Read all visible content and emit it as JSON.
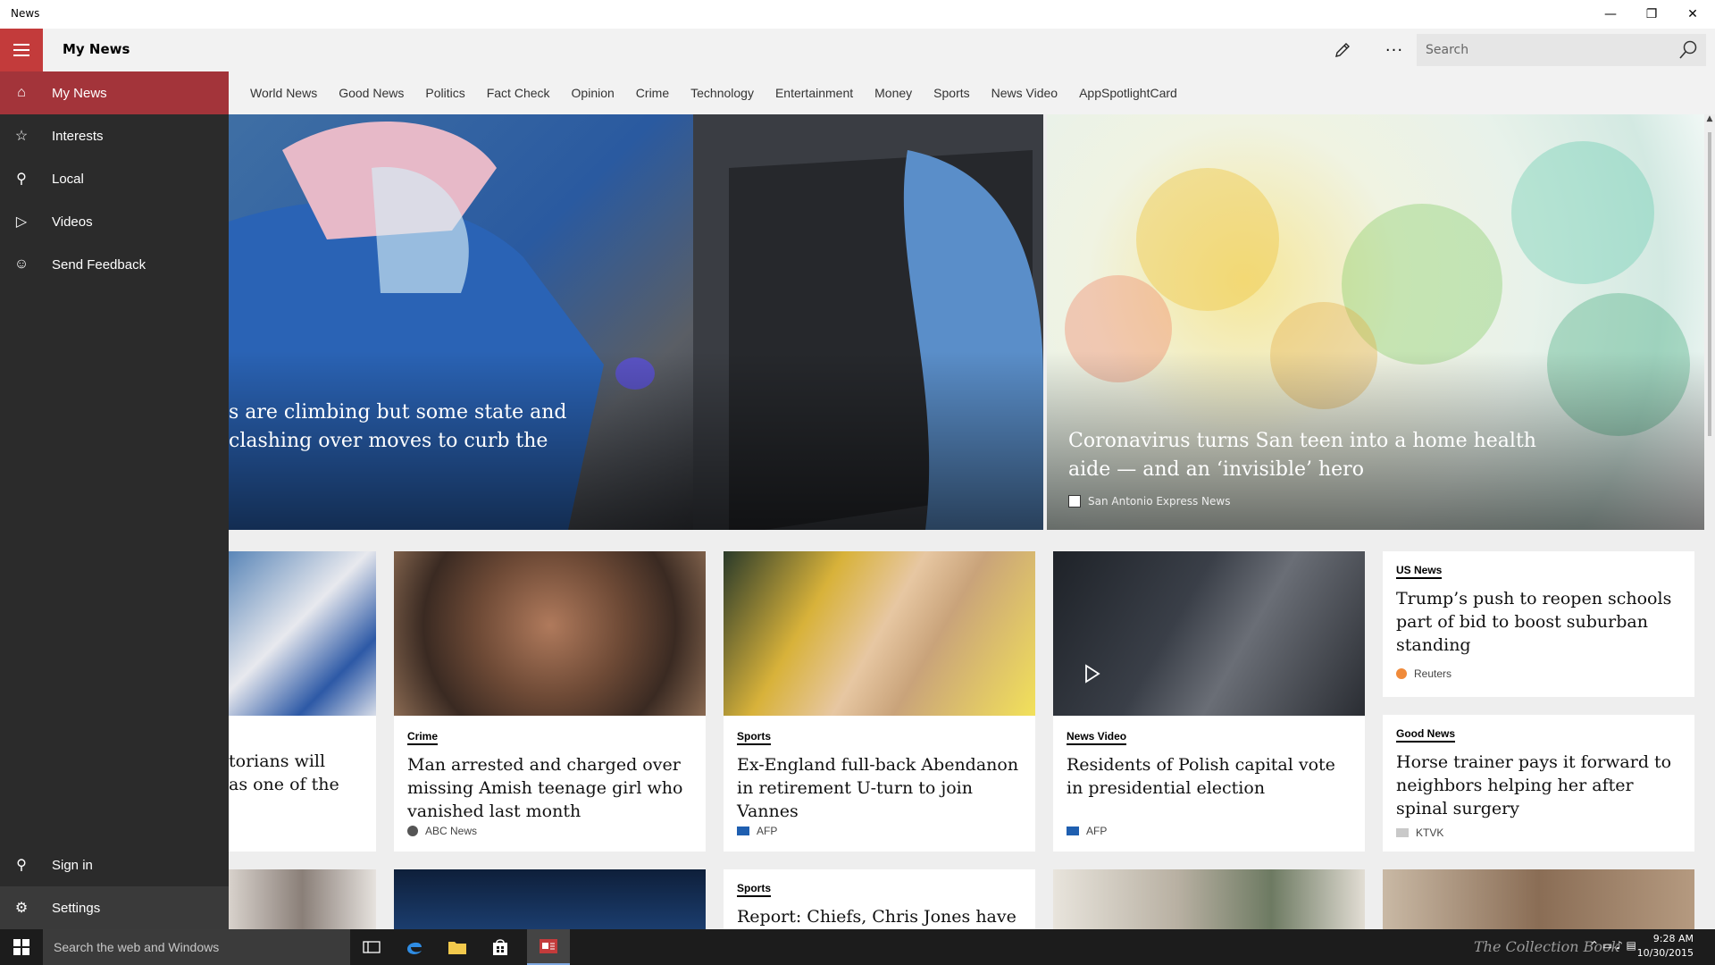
{
  "window": {
    "title": "News",
    "controls": {
      "minimize": "—",
      "maximize": "❐",
      "close": "✕"
    }
  },
  "header": {
    "app_title": "My News",
    "edit_icon": "pencil-icon",
    "more_label": "···",
    "search_placeholder": "Search"
  },
  "categories": [
    "World News",
    "Good News",
    "Politics",
    "Fact Check",
    "Opinion",
    "Crime",
    "Technology",
    "Entertainment",
    "Money",
    "Sports",
    "News Video",
    "AppSpotlightCard"
  ],
  "sidebar": {
    "items": [
      {
        "label": "My News",
        "icon": "home-icon",
        "glyph": "⌂",
        "active": true
      },
      {
        "label": "Interests",
        "icon": "star-list-icon",
        "glyph": "☆"
      },
      {
        "label": "Local",
        "icon": "person-icon",
        "glyph": "⚲"
      },
      {
        "label": "Videos",
        "icon": "play-icon",
        "glyph": "▷"
      },
      {
        "label": "Send Feedback",
        "icon": "smiley-icon",
        "glyph": "☺"
      }
    ],
    "bottom": [
      {
        "label": "Sign in",
        "icon": "person-icon",
        "glyph": "⚲"
      },
      {
        "label": "Settings",
        "icon": "gear-icon",
        "glyph": "⚙"
      }
    ]
  },
  "hero": [
    {
      "headline_line1": "s are climbing but some state and",
      "headline_line2": "clashing over moves to curb the"
    },
    {
      "headline_line1": "Coronavirus turns San teen into a home health",
      "headline_line2": "aide — and an ‘invisible’ hero",
      "source": "San Antonio Express News"
    }
  ],
  "cards_row1": [
    {
      "title_line1": "torians will",
      "title_line2": "as one of the"
    },
    {
      "tag": "Crime",
      "title": "Man arrested and charged over missing Amish teenage girl who vanished last month",
      "source": "ABC News"
    },
    {
      "tag": "Sports",
      "title": "Ex-England full-back Abendanon in retirement U-turn to join Vannes",
      "source": "AFP"
    },
    {
      "tag": "News Video",
      "title": "Residents of Polish capital vote in presidential election",
      "source": "AFP"
    }
  ],
  "side_cards": [
    {
      "tag": "US News",
      "title": "Trump’s push to reopen schools part of bid to boost suburban standing",
      "source": "Reuters"
    },
    {
      "tag": "Good News",
      "title": "Horse trainer pays it forward to neighbors helping her after spinal surgery",
      "source": "KTVK"
    }
  ],
  "cards_row2": [
    {
      "tag": "Sports",
      "title": "Report: Chiefs, Chris Jones have"
    }
  ],
  "taskbar": {
    "search_placeholder": "Search the web and Windows",
    "time": "9:28 AM",
    "date": "10/30/2015",
    "watermark": "The Collection Book"
  },
  "colors": {
    "accent": "#c33b3b",
    "sidebar_bg": "#2b2b2b",
    "active_item": "#a3343a"
  }
}
